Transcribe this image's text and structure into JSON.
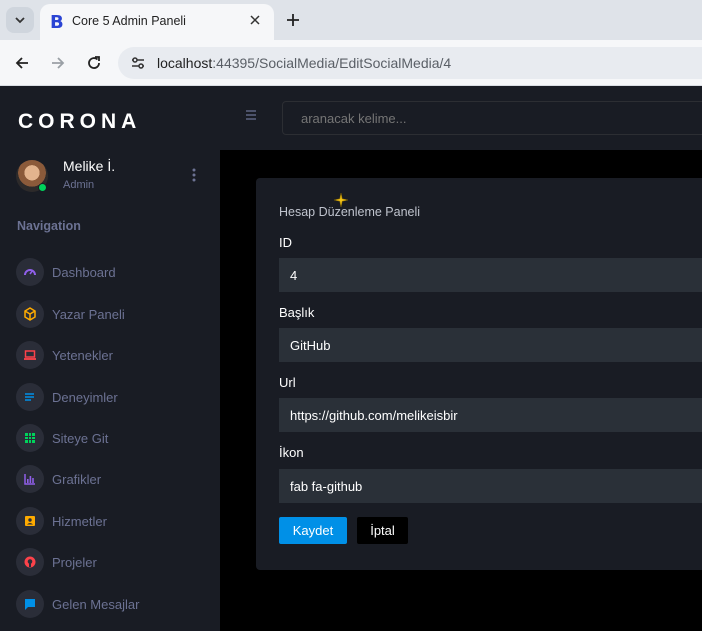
{
  "browser": {
    "tab_title": "Core 5 Admin Paneli",
    "favicon_letter": "B",
    "url_host": "localhost",
    "url_path": ":44395/SocialMedia/EditSocialMedia/4"
  },
  "sidebar": {
    "brand": "CORONA",
    "user": {
      "name": "Melike İ.",
      "role": "Admin"
    },
    "nav_title": "Navigation",
    "items": [
      {
        "label": "Dashboard",
        "icon": "speedometer-icon",
        "color": "#8f5fe8"
      },
      {
        "label": "Yazar Paneli",
        "icon": "cube-icon",
        "color": "#ffab00"
      },
      {
        "label": "Yetenekler",
        "icon": "laptop-icon",
        "color": "#fc424a"
      },
      {
        "label": "Deneyimler",
        "icon": "playlist-icon",
        "color": "#0090e7"
      },
      {
        "label": "Siteye Git",
        "icon": "table-icon",
        "color": "#00d25b"
      },
      {
        "label": "Grafikler",
        "icon": "chart-icon",
        "color": "#8f5fe8"
      },
      {
        "label": "Hizmetler",
        "icon": "contacts-icon",
        "color": "#ffab00"
      },
      {
        "label": "Projeler",
        "icon": "github-icon",
        "color": "#fc424a"
      },
      {
        "label": "Gelen Mesajlar",
        "icon": "chat-icon",
        "color": "#0090e7"
      }
    ]
  },
  "topbar": {
    "search_placeholder": "aranacak kelime..."
  },
  "form": {
    "title": "Hesap Düzenleme Paneli",
    "fields": [
      {
        "label": "ID",
        "value": "4"
      },
      {
        "label": "Başlık",
        "value": "GitHub"
      },
      {
        "label": "Url",
        "value": "https://github.com/melikeisbir"
      },
      {
        "label": "İkon",
        "value": "fab fa-github"
      }
    ],
    "save_label": "Kaydet",
    "cancel_label": "İptal"
  }
}
